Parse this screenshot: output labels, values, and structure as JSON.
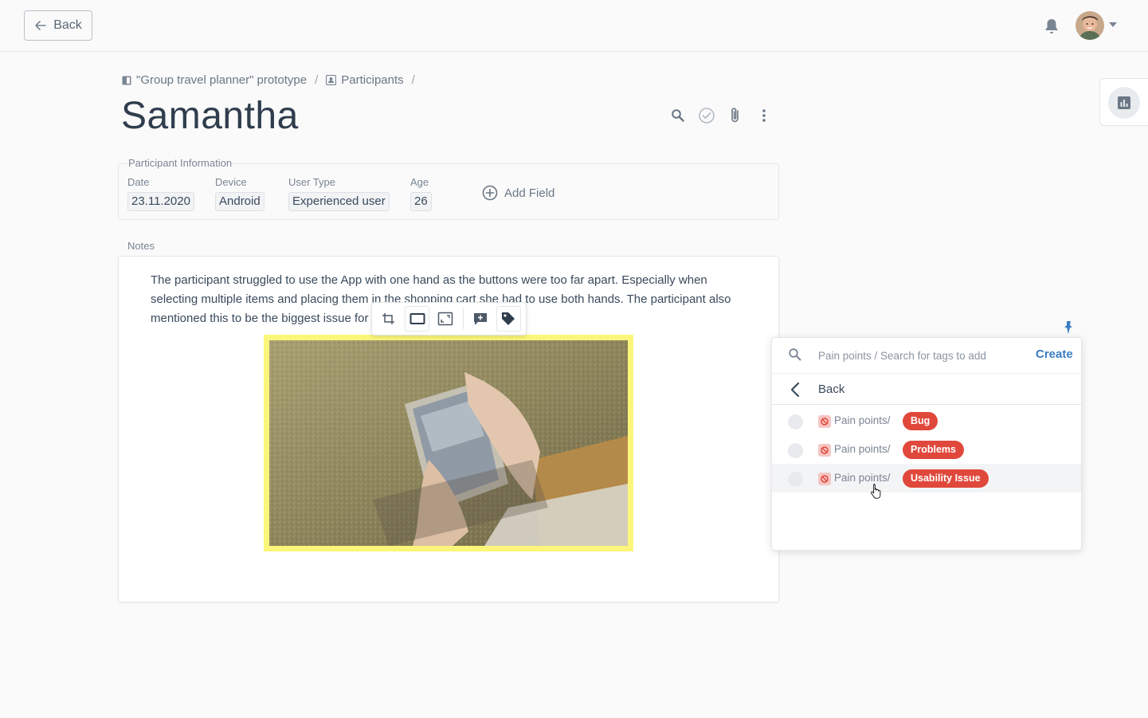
{
  "header": {
    "back_label": "Back"
  },
  "breadcrumb": {
    "project": "\"Group travel planner\" prototype",
    "section": "Participants",
    "separator": "/"
  },
  "page": {
    "title": "Samantha"
  },
  "participant_info": {
    "legend": "Participant Information",
    "fields": [
      {
        "label": "Date",
        "value": "23.11.2020"
      },
      {
        "label": "Device",
        "value": "Android"
      },
      {
        "label": "User Type",
        "value": "Experienced user"
      },
      {
        "label": "Age",
        "value": "26"
      }
    ],
    "add_field_label": "Add Field"
  },
  "notes": {
    "label": "Notes",
    "text_line1": "The participant struggled to use the App with one hand as the buttons were too far apart. Especially when",
    "text_line2": "selecting multiple items and placing them in the shopping cart she had to use both hands. The participant also",
    "text_line3": "mentioned this to be the biggest issue for"
  },
  "tag_panel": {
    "search_placeholder": "Pain points / Search for tags to add",
    "create_label": "Create",
    "back_label": "Back",
    "items": [
      {
        "path": "Pain points/",
        "tag": "Bug"
      },
      {
        "path": "Pain points/",
        "tag": "Problems"
      },
      {
        "path": "Pain points/",
        "tag": "Usability Issue"
      }
    ]
  },
  "colors": {
    "accent": "#3b7dc4",
    "tag_red": "#e0483b",
    "highlight_yellow": "#fbf67a"
  }
}
